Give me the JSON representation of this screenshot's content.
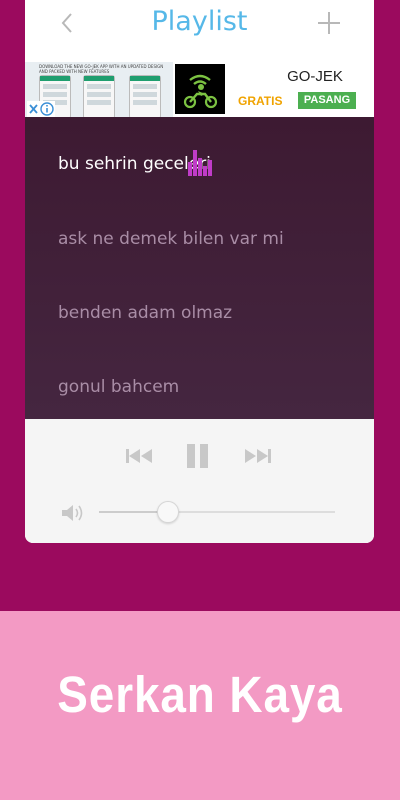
{
  "header": {
    "title": "Playlist",
    "back_icon": "chevron-left-icon",
    "add_icon": "plus-icon"
  },
  "ad": {
    "headline": "Download the new Go-Jek app with an updated design and packed with new features",
    "brand": "GO-JEK",
    "gratis": "GRATIS",
    "cta": "PASANG",
    "close_icon": "close-icon",
    "info_icon": "info-icon"
  },
  "playlist": {
    "tracks": [
      {
        "title": "bu sehrin geceleri",
        "active": true
      },
      {
        "title": "ask ne demek bilen var mi",
        "active": false
      },
      {
        "title": "benden adam olmaz",
        "active": false
      },
      {
        "title": "gonul bahcem",
        "active": false
      }
    ],
    "now_playing_icon": "equalizer-icon"
  },
  "controls": {
    "previous_icon": "skip-previous-icon",
    "pause_icon": "pause-icon",
    "next_icon": "skip-next-icon",
    "volume_icon": "volume-icon",
    "volume_level": 0.29
  },
  "banner": {
    "artist": "Serkan Kaya"
  },
  "colors": {
    "background": "#9b0a5e",
    "title": "#56b8e8",
    "playlist_bg": "#3d1a32",
    "banner": "#f39ac4",
    "equalizer": "#c03cc8"
  }
}
